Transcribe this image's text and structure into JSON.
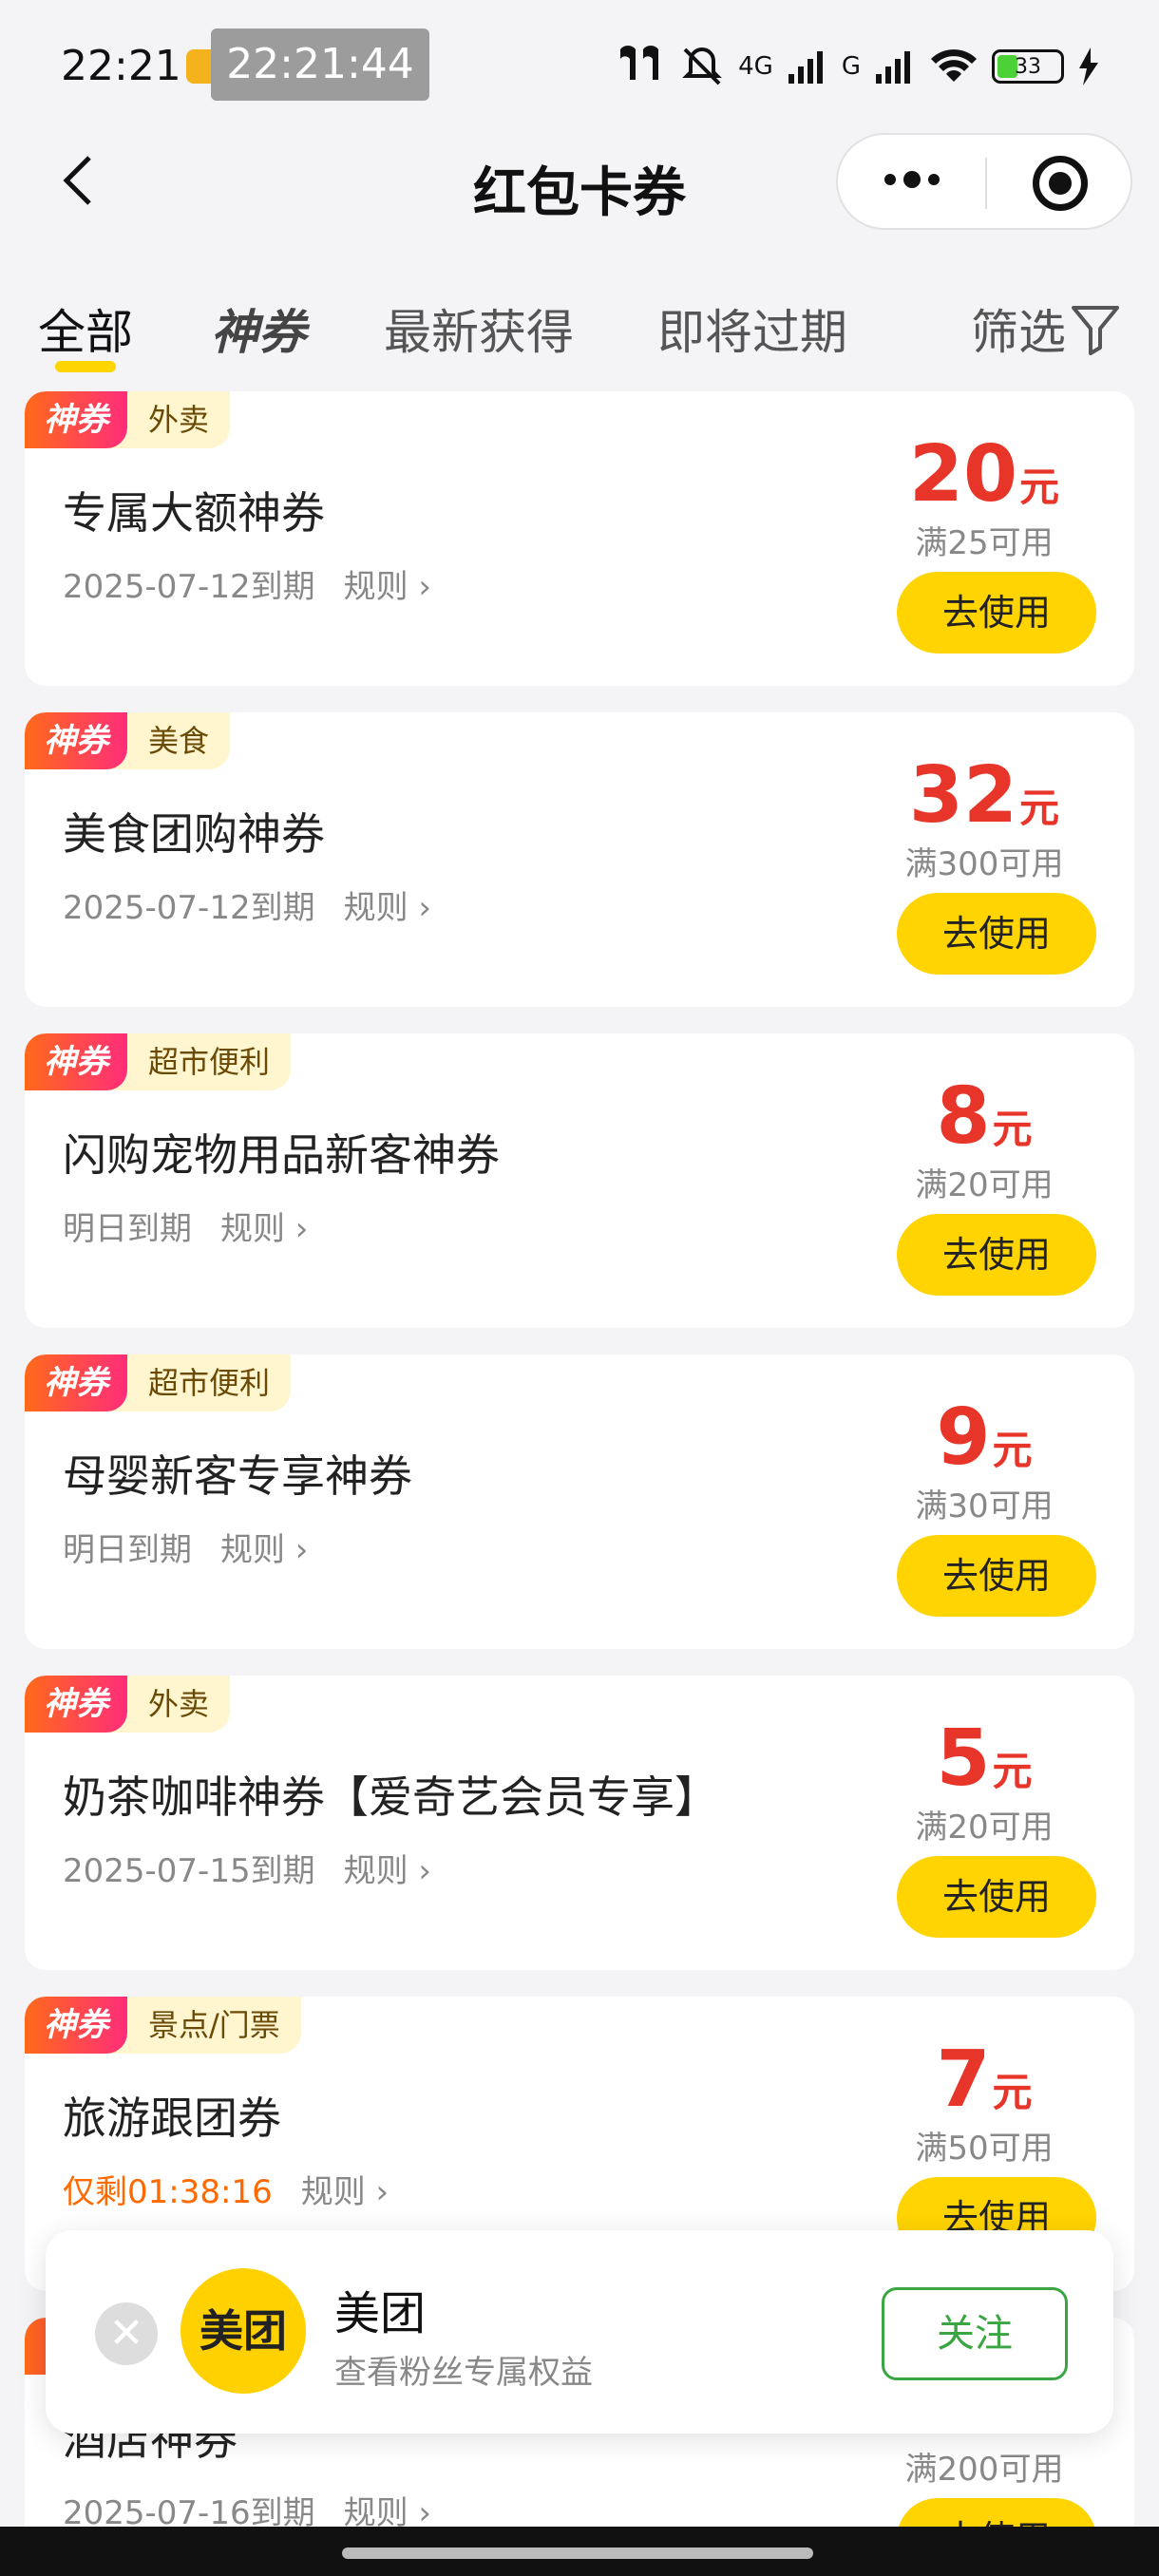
{
  "status_bar": {
    "time": "22:21",
    "overlay_time": "22:21:44",
    "network": "4G",
    "network2": "G",
    "battery": "33",
    "battery_level": 0.33
  },
  "header": {
    "title": "红包卡券",
    "back_icon": "chevron-left-icon",
    "more_icon": "more-dots-icon",
    "target_icon": "record-target-icon"
  },
  "tabs": [
    {
      "label": "全部",
      "active": true
    },
    {
      "label": "神券",
      "active": false
    },
    {
      "label": "最新获得",
      "active": false
    },
    {
      "label": "即将过期",
      "active": false
    },
    {
      "label": "筛选",
      "active": false
    }
  ],
  "badge_label": "神券",
  "rule_label": "规则 ›",
  "use_label": "去使用",
  "unit_label": "元",
  "coupons": [
    {
      "category": "外卖",
      "name": "专属大额神券",
      "expiry": "2025-07-12到期",
      "amount": "20",
      "condition": "满25可用"
    },
    {
      "category": "美食",
      "name": "美食团购神券",
      "expiry": "2025-07-12到期",
      "amount": "32",
      "condition": "满300可用"
    },
    {
      "category": "超市便利",
      "name": "闪购宠物用品新客神券",
      "expiry": "明日到期",
      "amount": "8",
      "condition": "满20可用"
    },
    {
      "category": "超市便利",
      "name": "母婴新客专享神券",
      "expiry": "明日到期",
      "amount": "9",
      "condition": "满30可用"
    },
    {
      "category": "外卖",
      "name": "奶茶咖啡神券【爱奇艺会员专享】",
      "expiry": "2025-07-15到期",
      "amount": "5",
      "condition": "满20可用"
    },
    {
      "category": "景点/门票",
      "name": "旅游跟团券",
      "expiry": "仅剩01:38:16",
      "amount": "7",
      "condition": "满50可用"
    },
    {
      "category": "",
      "name": "酒店神券",
      "expiry": "2025-07-16到期",
      "amount": "",
      "condition": "满200可用"
    }
  ],
  "popup": {
    "logo_text": "美团",
    "name": "美团",
    "subtitle": "查看粉丝专属权益",
    "follow_label": "关注",
    "close_icon": "close-icon"
  },
  "colors": {
    "accent": "#ffd400",
    "price": "#e8352a",
    "urgent": "#ff6a00",
    "follow": "#3aa542"
  }
}
